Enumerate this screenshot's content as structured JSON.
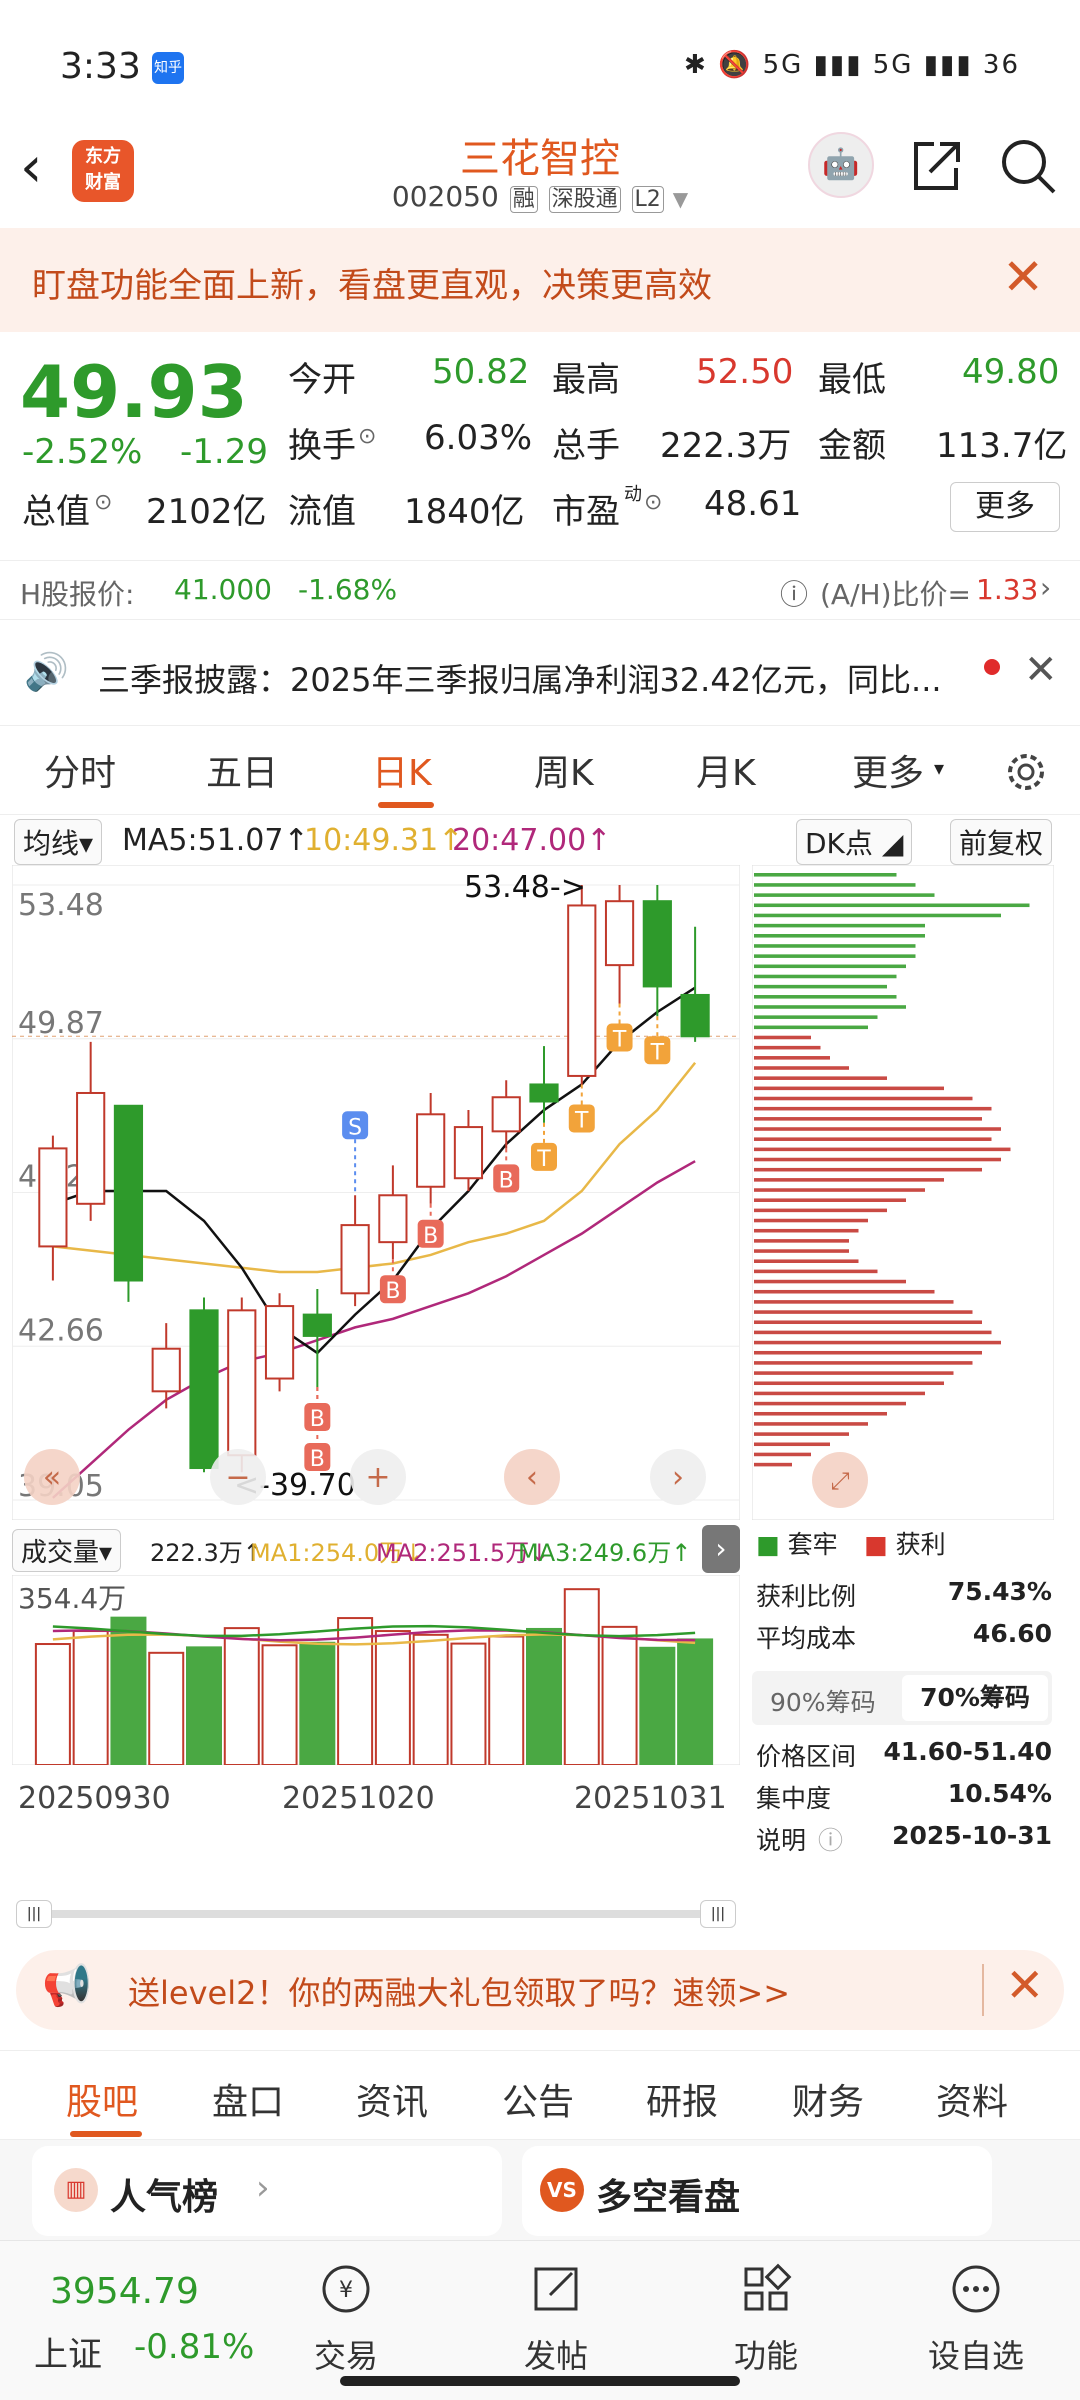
{
  "status": {
    "time": "3:33",
    "app_badge": "知乎",
    "right": "✱ 🔕 5G ▮▮▮ 5G ▮▮▮ 36"
  },
  "header": {
    "logo": "东方\n财富",
    "name": "三花智控",
    "code": "002050",
    "tags": [
      "融",
      "深股通",
      "L2"
    ]
  },
  "banner": {
    "text": "盯盘功能全面上新，看盘更直观，决策更高效"
  },
  "quote": {
    "price": "49.93",
    "pct": "-2.52%",
    "chg": "-1.29",
    "open_label": "今开",
    "open": "50.82",
    "high_label": "最高",
    "high": "52.50",
    "low_label": "最低",
    "low": "49.80",
    "turnover_label": "换手",
    "turnover": "6.03%",
    "vol_label": "总手",
    "vol": "222.3万",
    "amount_label": "金额",
    "amount": "113.7亿",
    "mcap_label": "总值",
    "mcap": "2102亿",
    "float_label": "流值",
    "float": "1840亿",
    "pe_label": "市盈",
    "pe_sup": "动",
    "pe": "48.61",
    "more": "更多"
  },
  "hshare": {
    "label": "H股报价:",
    "price": "41.000",
    "pct": "-1.68%",
    "ah_label": "(A/H)比价=",
    "ah": "1.33"
  },
  "notice": {
    "text": "三季报披露：2025年三季报归属净利润32.42亿元，同比..."
  },
  "tabs": [
    "分时",
    "五日",
    "日K",
    "周K",
    "月K",
    "更多"
  ],
  "ma": {
    "selector": "均线",
    "ma5": "MA5:51.07",
    "ma10": "10:49.31",
    "ma20": "20:47.00",
    "dk": "DK点",
    "adj": "前复权"
  },
  "kchart": {
    "y_labels": [
      "53.48",
      "49.87",
      "46.27",
      "42.66",
      "39.05"
    ],
    "hi_note": "53.48->",
    "lo_note": "<-39.70"
  },
  "chart_data": {
    "type": "candlestick",
    "y_range": [
      39.05,
      53.48
    ],
    "candles": [
      {
        "o": 45.0,
        "c": 47.3,
        "h": 47.6,
        "l": 44.2
      },
      {
        "o": 46.0,
        "c": 48.6,
        "h": 49.8,
        "l": 45.6
      },
      {
        "o": 48.3,
        "c": 44.2,
        "h": 48.3,
        "l": 43.7
      },
      {
        "o": 41.6,
        "c": 42.6,
        "h": 43.2,
        "l": 41.2
      },
      {
        "o": 43.5,
        "c": 39.8,
        "h": 43.8,
        "l": 39.7
      },
      {
        "o": 40.1,
        "c": 43.5,
        "h": 43.8,
        "l": 39.7
      },
      {
        "o": 41.9,
        "c": 43.6,
        "h": 43.9,
        "l": 41.6
      },
      {
        "o": 43.4,
        "c": 42.9,
        "h": 44.0,
        "l": 41.7
      },
      {
        "o": 43.9,
        "c": 45.5,
        "h": 46.2,
        "l": 43.6
      },
      {
        "o": 45.1,
        "c": 46.2,
        "h": 46.9,
        "l": 44.7
      },
      {
        "o": 46.4,
        "c": 48.1,
        "h": 48.6,
        "l": 46.0
      },
      {
        "o": 46.6,
        "c": 47.8,
        "h": 48.2,
        "l": 46.3
      },
      {
        "o": 47.7,
        "c": 48.5,
        "h": 48.9,
        "l": 47.3
      },
      {
        "o": 48.8,
        "c": 48.4,
        "h": 49.7,
        "l": 47.9
      },
      {
        "o": 49.0,
        "c": 53.0,
        "h": 53.48,
        "l": 48.8
      },
      {
        "o": 51.6,
        "c": 53.1,
        "h": 53.48,
        "l": 50.7
      },
      {
        "o": 53.1,
        "c": 51.1,
        "h": 53.48,
        "l": 50.4
      },
      {
        "o": 50.9,
        "c": 49.93,
        "h": 52.5,
        "l": 49.8
      }
    ],
    "ma5": [
      46.0,
      46.3,
      46.3,
      46.3,
      45.6,
      44.5,
      43.1,
      42.5,
      43.4,
      44.2,
      45.4,
      46.3,
      47.4,
      48.2,
      48.8,
      49.8,
      50.5,
      51.07
    ],
    "ma10": [
      45.0,
      44.9,
      44.8,
      44.7,
      44.6,
      44.5,
      44.4,
      44.4,
      44.5,
      44.6,
      44.8,
      45.1,
      45.3,
      45.6,
      46.3,
      47.4,
      48.2,
      49.31
    ],
    "ma20": [
      39.1,
      39.9,
      40.7,
      41.4,
      41.9,
      42.3,
      42.5,
      42.8,
      43.1,
      43.3,
      43.6,
      43.9,
      44.3,
      44.8,
      45.3,
      45.9,
      46.5,
      47.0
    ],
    "markers": [
      {
        "i": 8,
        "t": "S"
      },
      {
        "i": 7,
        "t": "B"
      },
      {
        "i": 9,
        "t": "B"
      },
      {
        "i": 10,
        "t": "B"
      },
      {
        "i": 12,
        "t": "B"
      },
      {
        "i": 13,
        "t": "T"
      },
      {
        "i": 14,
        "t": "T"
      },
      {
        "i": 15,
        "t": "T"
      },
      {
        "i": 16,
        "t": "T"
      },
      {
        "i": 7,
        "t": "B2"
      }
    ],
    "volumes": [
      289,
      320,
      352,
      268,
      281,
      327,
      286,
      292,
      351,
      320,
      311,
      290,
      307,
      325,
      420,
      330,
      280,
      300
    ],
    "volume_max": 354.4
  },
  "vol": {
    "selector": "成交量",
    "v": "222.3万",
    "ma1": "MA1:254.0万",
    "ma2": "MA2:251.5万",
    "ma3": "MA3:249.6万",
    "max_label": "354.4万",
    "dates": [
      "20250930",
      "20251020",
      "20251031"
    ]
  },
  "chips": {
    "legend_trap": "套牢",
    "legend_profit": "获利",
    "rows": [
      {
        "k": "获利比例",
        "v": "75.43%"
      },
      {
        "k": "平均成本",
        "v": "46.60"
      }
    ],
    "tab90": "90%筹码",
    "tab70": "70%筹码",
    "rows2": [
      {
        "k": "价格区间",
        "v": "41.60-51.40"
      },
      {
        "k": "集中度",
        "v": "10.54%"
      },
      {
        "k": "说明",
        "v": "2025-10-31"
      }
    ]
  },
  "promo": {
    "text": "送level2！你的两融大礼包领取了吗？速领>>"
  },
  "tabs2": [
    "股吧",
    "盘口",
    "资讯",
    "公告",
    "研报",
    "财务",
    "资料"
  ],
  "cards": [
    "人气榜",
    "多空看盘"
  ],
  "bottom": {
    "index_val": "3954.79",
    "index_name": "上证",
    "index_pct": "-0.81%",
    "items": [
      "交易",
      "发帖",
      "功能",
      "设自选"
    ]
  }
}
